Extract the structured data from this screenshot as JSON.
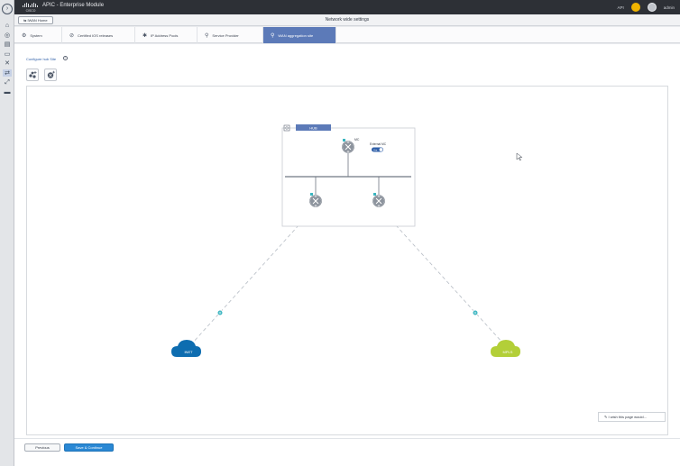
{
  "app": {
    "title": "APIC - Enterprise Module"
  },
  "topbar": {
    "settings_label": "API",
    "user": "admin"
  },
  "subheader": {
    "back_label": "IWAN Home",
    "page_title": "Network wide settings"
  },
  "tabs": [
    {
      "label": "System",
      "icon": "gear-icon",
      "active": false
    },
    {
      "label": "Certified IOS releases",
      "icon": "shield-icon",
      "active": false
    },
    {
      "label": "IP Address Pools",
      "icon": "star-icon",
      "active": false
    },
    {
      "label": "Service Provider",
      "icon": "pin-icon",
      "active": false
    },
    {
      "label": "WAN aggregation site",
      "icon": "pin-icon",
      "active": true
    }
  ],
  "main": {
    "configure_link": "Configure hub Site",
    "info_icon": "info-icon",
    "tools": [
      {
        "name": "add-devices-tool",
        "icon": "devices-add-icon"
      },
      {
        "name": "add-router-tool",
        "icon": "router-add-icon"
      }
    ]
  },
  "diagram": {
    "hub_label": "HUB",
    "mc_label": "MC",
    "toggle_label": "External MC",
    "toggle_state": "Yes",
    "clouds": [
      {
        "label": "INET",
        "color": "#0e6db0"
      },
      {
        "label": "MPLS",
        "color": "#b3cf38"
      }
    ],
    "link_dot_color": "#3ab5c0"
  },
  "footer": {
    "previous_label": "Previous",
    "save_label": "Save & Continue"
  },
  "feedback": {
    "label": "I wish this page would..."
  },
  "colors": {
    "accent": "#5c7ab8",
    "primary_button": "#2a88d4",
    "topbar": "#2d3036"
  }
}
